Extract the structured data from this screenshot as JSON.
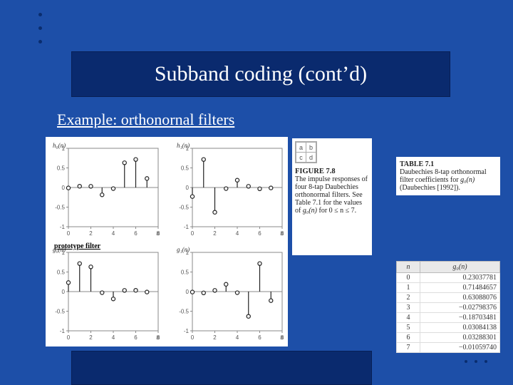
{
  "slide": {
    "title": "Subband coding (cont’d)",
    "example_label": "Example: orthonornal filters",
    "prototype_label": "prototype filter"
  },
  "figure_caption": {
    "grid": [
      "a",
      "b",
      "c",
      "d"
    ],
    "heading": "FIGURE 7.8",
    "body_1": "The impulse responses of four 8-tap Daubechies orthonormal filters. See Table 7.1 for the values of ",
    "g0": "g₀(n)",
    "body_2": " for 0 ≤ n ≤ 7."
  },
  "table_caption": {
    "heading": "TABLE 7.1",
    "body_1": "Daubechies 8-tap orthonormal filter coefficients for ",
    "g0": "g₀(n)",
    "body_2": " (Daubechies [1992])."
  },
  "table": {
    "col_n": "n",
    "col_g": "g₀(n)",
    "rows": [
      {
        "n": "0",
        "g": "0.23037781"
      },
      {
        "n": "1",
        "g": "0.71484657"
      },
      {
        "n": "2",
        "g": "0.63088076"
      },
      {
        "n": "3",
        "g": "−0.02798376"
      },
      {
        "n": "4",
        "g": "−0.18703481"
      },
      {
        "n": "5",
        "g": "0.03084138"
      },
      {
        "n": "6",
        "g": "0.03288301"
      },
      {
        "n": "7",
        "g": "−0.01059740"
      }
    ]
  },
  "chart_data": [
    {
      "type": "bar",
      "name": "h0(n)",
      "title": "h₀(n)",
      "xlabel": "n",
      "ylabel": "h₀(n)",
      "categories": [
        0,
        1,
        2,
        3,
        4,
        5,
        6,
        7
      ],
      "values": [
        -0.0106,
        0.0329,
        0.0308,
        -0.187,
        -0.028,
        0.6309,
        0.7148,
        0.2304
      ],
      "xlim": [
        0,
        8
      ],
      "ylim": [
        -1,
        1
      ]
    },
    {
      "type": "bar",
      "name": "h1(n)",
      "title": "h₁(n)",
      "xlabel": "n",
      "ylabel": "h₁(n)",
      "categories": [
        0,
        1,
        2,
        3,
        4,
        5,
        6,
        7
      ],
      "values": [
        -0.2304,
        0.7148,
        -0.6309,
        -0.028,
        0.187,
        0.0308,
        -0.0329,
        -0.0106
      ],
      "xlim": [
        0,
        8
      ],
      "ylim": [
        -1,
        1
      ]
    },
    {
      "type": "bar",
      "name": "g0(n)",
      "title": "g₀(n)",
      "xlabel": "n",
      "ylabel": "g₀(n)",
      "categories": [
        0,
        1,
        2,
        3,
        4,
        5,
        6,
        7
      ],
      "values": [
        0.2304,
        0.7148,
        0.6309,
        -0.028,
        -0.187,
        0.0308,
        0.0329,
        -0.0106
      ],
      "xlim": [
        0,
        8
      ],
      "ylim": [
        -1,
        1
      ]
    },
    {
      "type": "bar",
      "name": "g1(n)",
      "title": "g₁(n)",
      "xlabel": "n",
      "ylabel": "g₁(n)",
      "categories": [
        0,
        1,
        2,
        3,
        4,
        5,
        6,
        7
      ],
      "values": [
        -0.0106,
        -0.0329,
        0.0308,
        0.187,
        -0.028,
        -0.6309,
        0.7148,
        -0.2304
      ],
      "xlim": [
        0,
        8
      ],
      "ylim": [
        -1,
        1
      ]
    }
  ],
  "plot_layout": {
    "yticks": [
      -1,
      -0.5,
      0,
      0.5,
      1
    ],
    "xticks": [
      0,
      2,
      4,
      6,
      8
    ]
  }
}
